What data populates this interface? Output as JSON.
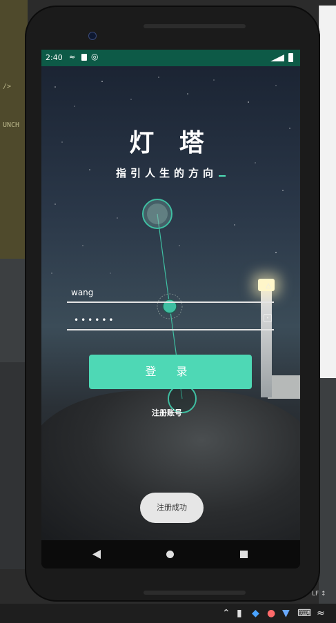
{
  "ide": {
    "code_line_1": "/>",
    "code_line_2": "UNCH",
    "line_ending": "LF ↕"
  },
  "statusbar": {
    "time": "2:40",
    "icons": [
      "wifi-icon",
      "sd-card-icon",
      "sync-icon",
      "signal-icon",
      "battery-icon"
    ]
  },
  "app": {
    "title": "灯 塔",
    "subtitle": "指引人生的方向",
    "username_value": "wang",
    "password_value": "••••••",
    "login_label": "登 录",
    "register_label": "注册账号",
    "toast_message": "注册成功",
    "accent_color": "#4ed8b5"
  },
  "navbar": {
    "back_icon": "back-triangle-icon",
    "home_icon": "home-circle-icon",
    "recents_icon": "recents-square-icon"
  }
}
